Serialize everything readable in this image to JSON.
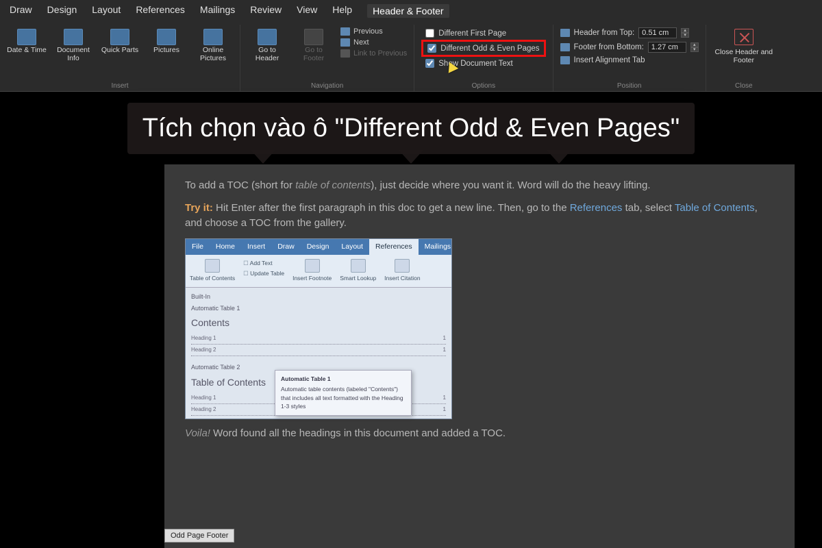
{
  "menu": {
    "items": [
      "Draw",
      "Design",
      "Layout",
      "References",
      "Mailings",
      "Review",
      "View",
      "Help",
      "Header & Footer"
    ],
    "active_index": 8
  },
  "ribbon": {
    "insert": {
      "label": "Insert",
      "buttons": {
        "date_time": "Date & Time",
        "document_info": "Document Info",
        "quick_parts": "Quick Parts",
        "pictures": "Pictures",
        "online_pictures": "Online Pictures"
      }
    },
    "navigation": {
      "label": "Navigation",
      "go_to_header": "Go to Header",
      "go_to_footer": "Go to Footer",
      "previous": "Previous",
      "next": "Next",
      "link_to_previous": "Link to Previous"
    },
    "options": {
      "label": "Options",
      "different_first_page": "Different First Page",
      "different_odd_even": "Different Odd & Even Pages",
      "show_document_text": "Show Document Text",
      "checked": {
        "first_page": false,
        "odd_even": true,
        "show_text": true
      }
    },
    "position": {
      "label": "Position",
      "header_from_top": "Header from Top:",
      "footer_from_bottom": "Footer from Bottom:",
      "insert_alignment_tab": "Insert Alignment Tab",
      "header_value": "0.51 cm",
      "footer_value": "1.27 cm"
    },
    "close": {
      "label": "Close",
      "button": "Close Header and Footer"
    }
  },
  "callout": {
    "text": "Tích chọn vào ô \"Different Odd & Even Pages\""
  },
  "document": {
    "p1a": "To add a TOC (short for ",
    "p1_ital": "table of contents",
    "p1b": "), just decide where you want it. Word will do the heavy lifting.",
    "p2_bold": "Try it:",
    "p2a": " Hit Enter after the first paragraph in this doc to get a new line. Then, go to the ",
    "p2_link1": "References",
    "p2b": " tab, select ",
    "p2_link2": "Table of Contents",
    "p2c": ", and choose a TOC from the gallery.",
    "p3_ital": "Voila!",
    "p3": " Word found all the headings in this document and added a TOC."
  },
  "embed": {
    "tabs": [
      "File",
      "Home",
      "Insert",
      "Draw",
      "Design",
      "Layout",
      "References",
      "Mailings"
    ],
    "tabs_selected_index": 6,
    "rib": {
      "toc": "Table of Contents",
      "add_text": "Add Text",
      "update_table": "Update Table",
      "insert_footnote": "Insert Footnote",
      "smart_lookup": "Smart Lookup",
      "insert_citation": "Insert Citation"
    },
    "builtin_label": "Built-In",
    "auto1": "Automatic Table 1",
    "contents_title": "Contents",
    "heading1": "Heading 1",
    "heading2": "Heading 2",
    "auto2": "Automatic Table 2",
    "toc_title": "Table of Contents",
    "tooltip_title": "Automatic Table 1",
    "tooltip_body": "Automatic table contents (labeled \"Contents\") that includes all text formatted with the Heading 1-3 styles"
  },
  "footer_chip": "Odd Page Footer"
}
